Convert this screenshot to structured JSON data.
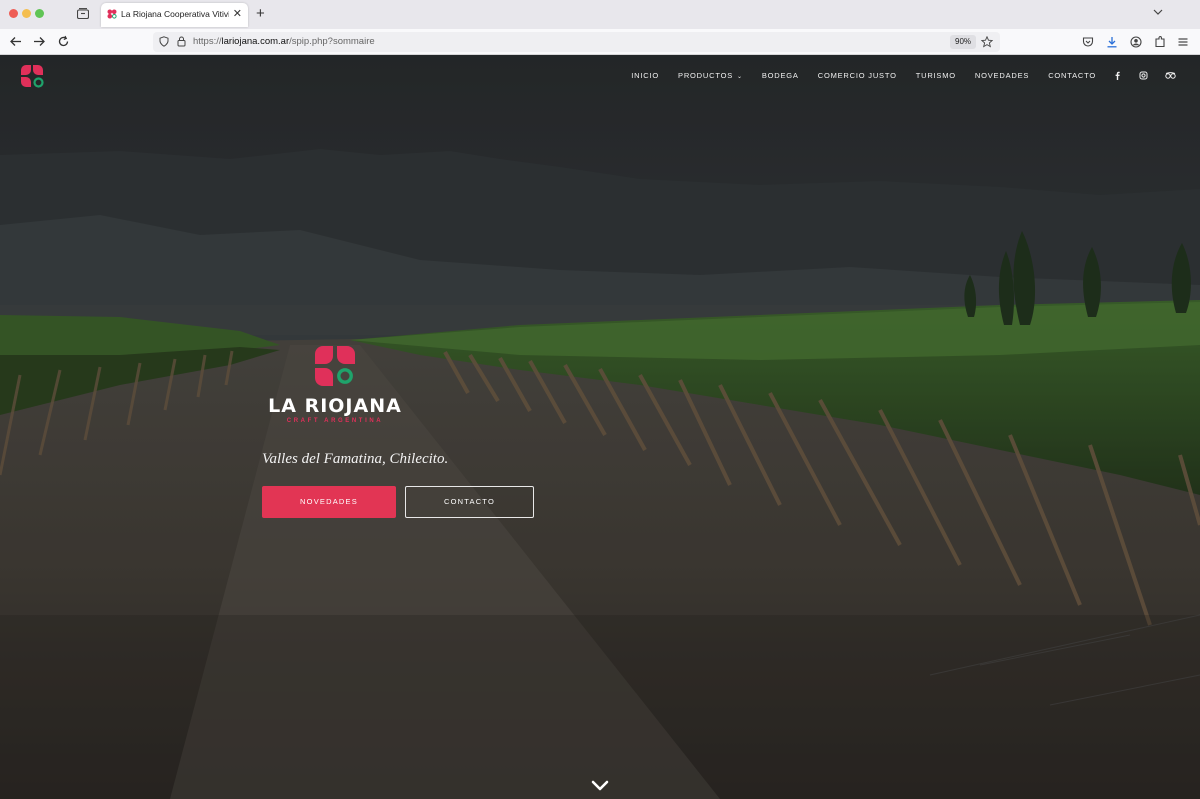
{
  "browser": {
    "tab_title": "La Riojana Cooperativa Vitivinic",
    "url_scheme": "https://",
    "url_host": "lariojana.com.ar",
    "url_path": "/spip.php?sommaire",
    "zoom": "90%"
  },
  "site": {
    "menu": [
      {
        "label": "INICIO"
      },
      {
        "label": "PRODUCTOS",
        "has_dropdown": true
      },
      {
        "label": "BODEGA"
      },
      {
        "label": "COMERCIO JUSTO"
      },
      {
        "label": "TURISMO"
      },
      {
        "label": "NOVEDADES"
      },
      {
        "label": "CONTACTO"
      }
    ],
    "social_icons": [
      "facebook-icon",
      "instagram-icon",
      "tripadvisor-icon"
    ],
    "brand_name": "LA RIOJANA",
    "brand_sub": "CRAFT ARGENTINA",
    "tagline": "Valles del Famatina, Chilecito.",
    "cta_primary": "NOVEDADES",
    "cta_secondary": "CONTACTO",
    "colors": {
      "accent": "#e23554",
      "logo_red": "#e0305a",
      "logo_green": "#1fa36b"
    }
  }
}
